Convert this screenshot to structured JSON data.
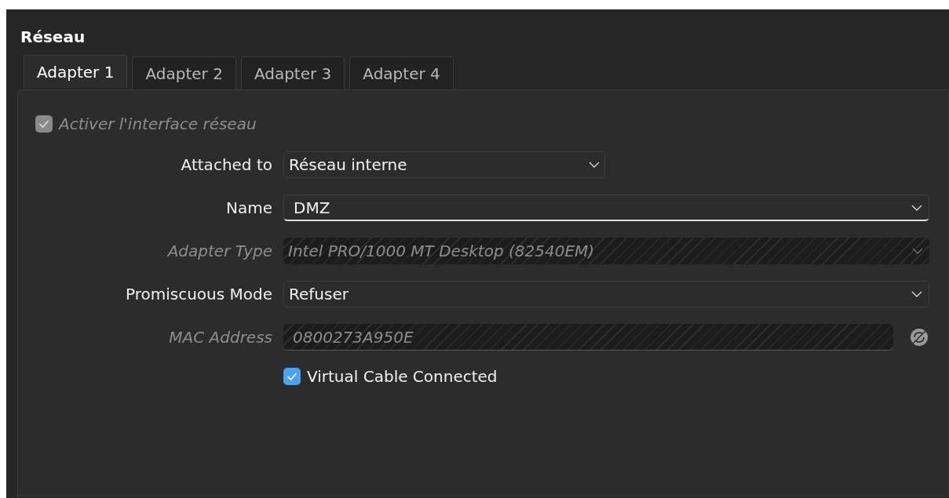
{
  "section": {
    "title": "Réseau"
  },
  "tabs": [
    {
      "label": "Adapter 1",
      "selected": true
    },
    {
      "label": "Adapter 2",
      "selected": false
    },
    {
      "label": "Adapter 3",
      "selected": false
    },
    {
      "label": "Adapter 4",
      "selected": false
    }
  ],
  "enable_checkbox": {
    "label": "Activer l'interface réseau",
    "checked": true,
    "disabled": true
  },
  "fields": [
    {
      "label": "Attached to",
      "value": "Réseau interne",
      "kind": "select",
      "disabled": false
    },
    {
      "label": "Name",
      "value": "DMZ",
      "kind": "combo",
      "disabled": false
    },
    {
      "label": "Adapter Type",
      "value": "Intel PRO/1000 MT Desktop (82540EM)",
      "kind": "dropdown",
      "disabled": true
    },
    {
      "label": "Promiscuous Mode",
      "value": "Refuser",
      "kind": "dropdown",
      "disabled": false
    },
    {
      "label": "MAC Address",
      "value": "0800273A950E",
      "kind": "mac",
      "disabled": true
    }
  ],
  "cable_checkbox": {
    "label": "Virtual Cable Connected",
    "checked": true,
    "disabled": false
  }
}
